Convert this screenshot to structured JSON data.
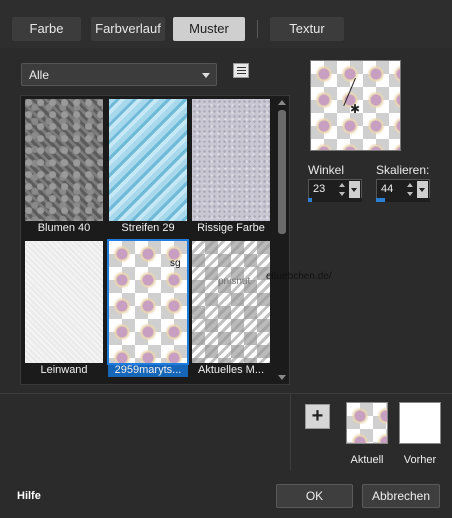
{
  "tabs": [
    {
      "label": "Farbe",
      "active": false
    },
    {
      "label": "Farbverlauf",
      "active": false
    },
    {
      "label": "Muster",
      "active": true
    },
    {
      "label": "Textur",
      "active": false
    }
  ],
  "category": {
    "selected": "Alle"
  },
  "patterns": [
    {
      "label": "Blumen 40",
      "texture": "flower",
      "selected": false
    },
    {
      "label": "Streifen 29",
      "texture": "stripes",
      "selected": false
    },
    {
      "label": "Rissige Farbe",
      "texture": "cracked",
      "selected": false
    },
    {
      "label": "Leinwand",
      "texture": "canvas",
      "selected": false
    },
    {
      "label": "2959maryts...",
      "texture": "pattern",
      "selected": true
    },
    {
      "label": "Aktuelles M...",
      "texture": "current",
      "selected": false
    }
  ],
  "watermark": {
    "left": "sg",
    "mid": "pnisnut",
    "right": "eltuebchen.de/"
  },
  "params": {
    "angle": {
      "label": "Winkel",
      "value": "23"
    },
    "scale": {
      "label": "Skalieren:",
      "value": "44"
    }
  },
  "swatches": {
    "current_label": "Aktuell",
    "previous_label": "Vorher",
    "previous_color": "#ffffff"
  },
  "footer": {
    "help": "Hilfe",
    "ok": "OK",
    "cancel": "Abbrechen"
  },
  "colors": {
    "accent": "#1565b8",
    "background": "#2b2b2b"
  }
}
